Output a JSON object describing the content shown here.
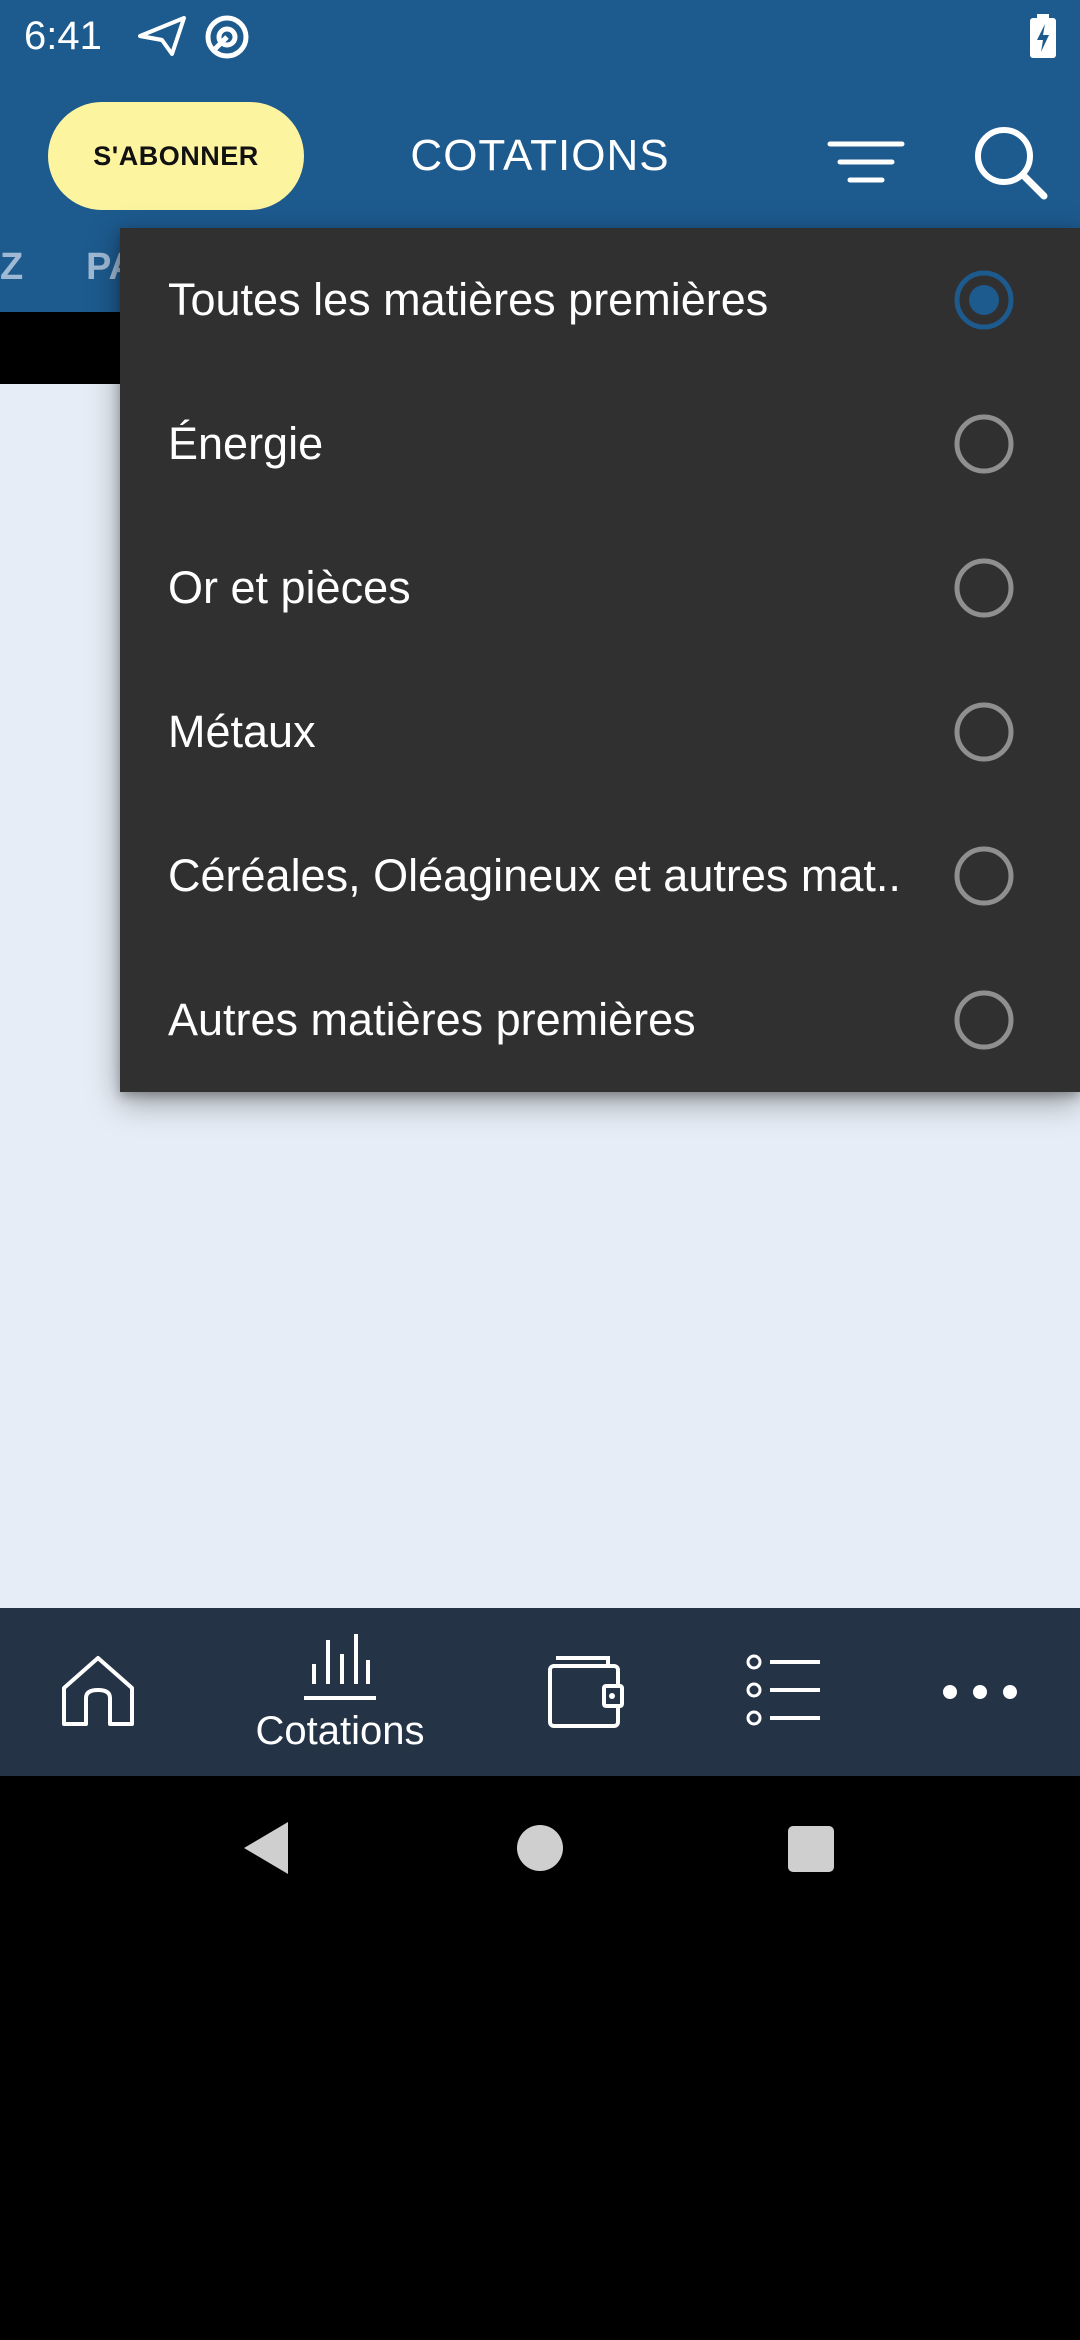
{
  "status_bar": {
    "time": "6:41",
    "icons": [
      "send-icon",
      "vpn-icon",
      "battery-charging-icon"
    ]
  },
  "app_bar": {
    "subscribe_label": "S'ABONNER",
    "title": "COTATIONS",
    "filter_icon": "filter-icon",
    "search_icon": "search-icon",
    "partial_tabs": [
      "Z",
      "PA"
    ]
  },
  "dropdown": {
    "selected_index": 0,
    "items": [
      {
        "label": "Toutes les matières premières",
        "selected": true
      },
      {
        "label": "Énergie",
        "selected": false
      },
      {
        "label": "Or et pièces",
        "selected": false
      },
      {
        "label": "Métaux",
        "selected": false
      },
      {
        "label": "Céréales, Oléagineux et autres mat..",
        "selected": false
      },
      {
        "label": "Autres matières premières",
        "selected": false
      }
    ]
  },
  "bottom_nav": {
    "items": [
      {
        "icon": "home-icon",
        "label": ""
      },
      {
        "icon": "chart-icon",
        "label": "Cotations"
      },
      {
        "icon": "wallet-icon",
        "label": ""
      },
      {
        "icon": "list-icon",
        "label": ""
      },
      {
        "icon": "more-icon",
        "label": ""
      }
    ]
  },
  "system_nav": {
    "icons": [
      "back-icon",
      "home-circle-icon",
      "recents-icon"
    ]
  },
  "colors": {
    "primary": "#1d5a8e",
    "subscribe_bg": "#fdf4a0",
    "dropdown_bg": "#303030",
    "content_bg": "#e6edf6",
    "bottom_nav_bg": "#243346",
    "radio_selected": "#1d5a8e",
    "radio_unselected": "#8f8f8f"
  }
}
